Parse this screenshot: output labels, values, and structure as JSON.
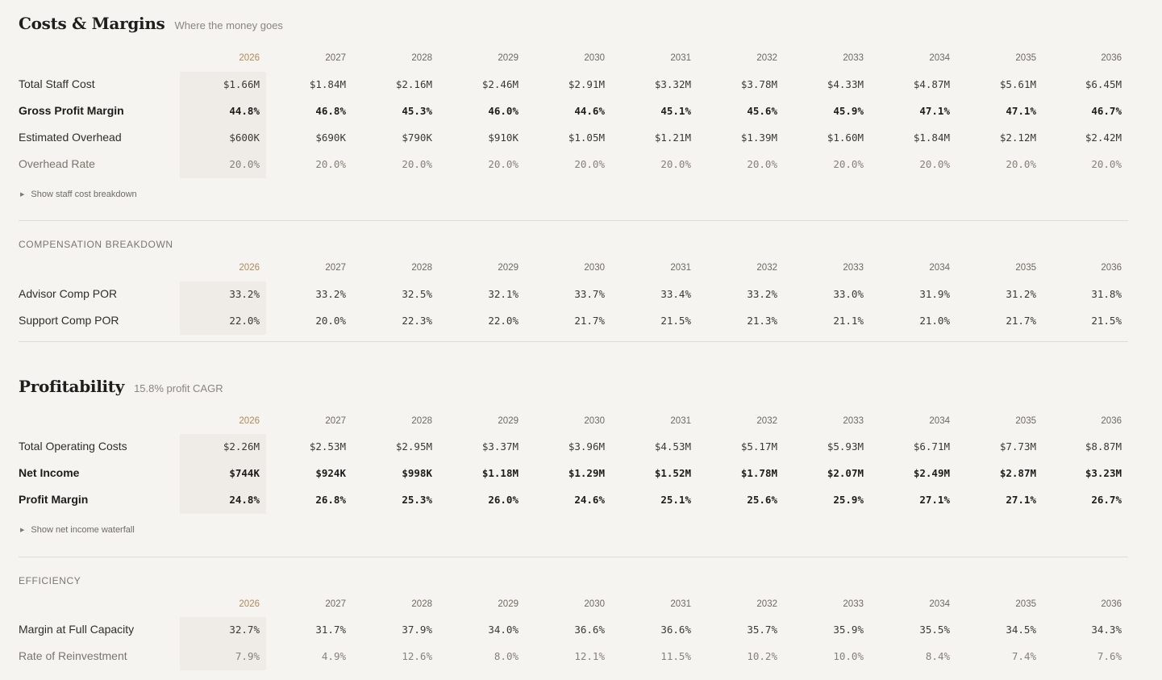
{
  "years": [
    "2026",
    "2027",
    "2028",
    "2029",
    "2030",
    "2031",
    "2032",
    "2033",
    "2034",
    "2035",
    "2036"
  ],
  "costs": {
    "title": "Costs & Margins",
    "subtitle": "Where the money goes",
    "rows": [
      {
        "label": "Total Staff Cost",
        "values": [
          "$1.66M",
          "$1.84M",
          "$2.16M",
          "$2.46M",
          "$2.91M",
          "$3.32M",
          "$3.78M",
          "$4.33M",
          "$4.87M",
          "$5.61M",
          "$6.45M"
        ]
      },
      {
        "label": "Gross Profit Margin",
        "values": [
          "44.8%",
          "46.8%",
          "45.3%",
          "46.0%",
          "44.6%",
          "45.1%",
          "45.6%",
          "45.9%",
          "47.1%",
          "47.1%",
          "46.7%"
        ]
      },
      {
        "label": "Estimated Overhead",
        "values": [
          "$600K",
          "$690K",
          "$790K",
          "$910K",
          "$1.05M",
          "$1.21M",
          "$1.39M",
          "$1.60M",
          "$1.84M",
          "$2.12M",
          "$2.42M"
        ]
      },
      {
        "label": "Overhead Rate",
        "values": [
          "20.0%",
          "20.0%",
          "20.0%",
          "20.0%",
          "20.0%",
          "20.0%",
          "20.0%",
          "20.0%",
          "20.0%",
          "20.0%",
          "20.0%"
        ]
      }
    ],
    "toggle": "Show staff cost breakdown"
  },
  "compensation": {
    "heading": "COMPENSATION BREAKDOWN",
    "rows": [
      {
        "label": "Advisor Comp POR",
        "values": [
          "33.2%",
          "33.2%",
          "32.5%",
          "32.1%",
          "33.7%",
          "33.4%",
          "33.2%",
          "33.0%",
          "31.9%",
          "31.2%",
          "31.8%"
        ]
      },
      {
        "label": "Support Comp POR",
        "values": [
          "22.0%",
          "20.0%",
          "22.3%",
          "22.0%",
          "21.7%",
          "21.5%",
          "21.3%",
          "21.1%",
          "21.0%",
          "21.7%",
          "21.5%"
        ]
      }
    ]
  },
  "profitability": {
    "title": "Profitability",
    "subtitle": "15.8% profit CAGR",
    "rows": [
      {
        "label": "Total Operating Costs",
        "values": [
          "$2.26M",
          "$2.53M",
          "$2.95M",
          "$3.37M",
          "$3.96M",
          "$4.53M",
          "$5.17M",
          "$5.93M",
          "$6.71M",
          "$7.73M",
          "$8.87M"
        ]
      },
      {
        "label": "Net Income",
        "values": [
          "$744K",
          "$924K",
          "$998K",
          "$1.18M",
          "$1.29M",
          "$1.52M",
          "$1.78M",
          "$2.07M",
          "$2.49M",
          "$2.87M",
          "$3.23M"
        ]
      },
      {
        "label": "Profit Margin",
        "values": [
          "24.8%",
          "26.8%",
          "25.3%",
          "26.0%",
          "24.6%",
          "25.1%",
          "25.6%",
          "25.9%",
          "27.1%",
          "27.1%",
          "26.7%"
        ]
      }
    ],
    "toggle": "Show net income waterfall"
  },
  "efficiency": {
    "heading": "EFFICIENCY",
    "rows": [
      {
        "label": "Margin at Full Capacity",
        "values": [
          "32.7%",
          "31.7%",
          "37.9%",
          "34.0%",
          "36.6%",
          "36.6%",
          "35.7%",
          "35.9%",
          "35.5%",
          "34.5%",
          "34.3%"
        ]
      },
      {
        "label": "Rate of Reinvestment",
        "values": [
          "7.9%",
          "4.9%",
          "12.6%",
          "8.0%",
          "12.1%",
          "11.5%",
          "10.2%",
          "10.0%",
          "8.4%",
          "7.4%",
          "7.6%"
        ]
      }
    ]
  }
}
